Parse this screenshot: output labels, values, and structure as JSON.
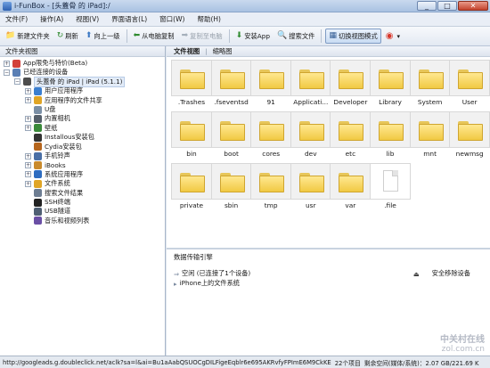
{
  "window": {
    "title": "i-FunBox - [头蓋骨 的 iPad]:/"
  },
  "menu": [
    "文件(F)",
    "操作(A)",
    "视图(V)",
    "界面语言(L)",
    "窗口(W)",
    "帮助(H)"
  ],
  "toolbar": [
    {
      "label": "新建文件夹",
      "icon": "folder-plus-icon",
      "glyph": "📁",
      "color": "#d4a019",
      "disabled": false
    },
    {
      "label": "刷新",
      "icon": "refresh-icon",
      "glyph": "↻",
      "color": "#2f8a2f",
      "disabled": false
    },
    {
      "label": "向上一级",
      "icon": "arrow-up-icon",
      "glyph": "⬆",
      "color": "#3b78c4",
      "disabled": false
    },
    {
      "label": "从电脑复制",
      "icon": "copy-from-pc-icon",
      "glyph": "⬅",
      "color": "#2f8a2f",
      "disabled": false
    },
    {
      "label": "复制至电脑",
      "icon": "copy-to-pc-icon",
      "glyph": "➡",
      "color": "#a5b0bb",
      "disabled": true
    },
    {
      "label": "安装App",
      "icon": "install-app-icon",
      "glyph": "⬇",
      "color": "#2f8a2f",
      "disabled": false
    },
    {
      "label": "搜索文件",
      "icon": "search-icon",
      "glyph": "🔍",
      "color": "#355e95",
      "disabled": false
    },
    {
      "label": "切换视图模式",
      "icon": "view-toggle-icon",
      "glyph": "▦",
      "color": "#355e95",
      "disabled": false,
      "active": true
    }
  ],
  "left_pane": {
    "header": "文件夹视图",
    "tree": [
      {
        "label": "App限免与特价(Beta)",
        "level": 0,
        "expander": "+",
        "icon": "apple-icon",
        "color": "#d2413a"
      },
      {
        "label": "已经连接的设备",
        "level": 0,
        "expander": "−",
        "icon": "devices-icon",
        "color": "#5a7fb5"
      },
      {
        "label": "头蓋骨 的 iPad | iPad (5.1.1)",
        "level": 1,
        "expander": "−",
        "icon": "ipad-icon",
        "color": "#4d4d4d",
        "selected": true
      },
      {
        "label": "用户应用程序",
        "level": 2,
        "expander": "+",
        "icon": "user-apps-icon",
        "color": "#3b7fd0"
      },
      {
        "label": "应用程序的文件共享",
        "level": 2,
        "expander": "+",
        "icon": "file-share-icon",
        "color": "#e0a526"
      },
      {
        "label": "U盘",
        "level": 2,
        "expander": "",
        "icon": "usb-drive-icon",
        "color": "#7a8fa6"
      },
      {
        "label": "内置相机",
        "level": 2,
        "expander": "+",
        "icon": "camera-icon",
        "color": "#555f6b"
      },
      {
        "label": "壁纸",
        "level": 2,
        "expander": "+",
        "icon": "wallpaper-icon",
        "color": "#3a8a3a"
      },
      {
        "label": "Installous安装包",
        "level": 2,
        "expander": "",
        "icon": "installous-icon",
        "color": "#333333"
      },
      {
        "label": "Cydia安装包",
        "level": 2,
        "expander": "",
        "icon": "cydia-icon",
        "color": "#b5651d"
      },
      {
        "label": "手机铃声",
        "level": 2,
        "expander": "+",
        "icon": "ringtone-icon",
        "color": "#4a6fa5"
      },
      {
        "label": "iBooks",
        "level": 2,
        "expander": "+",
        "icon": "ibooks-icon",
        "color": "#c98a2c"
      },
      {
        "label": "系统应用程序",
        "level": 2,
        "expander": "+",
        "icon": "system-apps-icon",
        "color": "#2d6cc0"
      },
      {
        "label": "文件系统",
        "level": 2,
        "expander": "+",
        "icon": "file-system-icon",
        "color": "#e0a526"
      },
      {
        "label": "搜索文件结果",
        "level": 2,
        "expander": "",
        "icon": "search-results-icon",
        "color": "#6d7d92"
      },
      {
        "label": "SSH终端",
        "level": 2,
        "expander": "",
        "icon": "ssh-terminal-icon",
        "color": "#222222"
      },
      {
        "label": "USB隧道",
        "level": 2,
        "expander": "",
        "icon": "usb-tunnel-icon",
        "color": "#4f5f73"
      },
      {
        "label": "音乐和视频列表",
        "level": 2,
        "expander": "",
        "icon": "media-list-icon",
        "color": "#6a4fa5"
      }
    ]
  },
  "right_pane": {
    "tabs": [
      {
        "label": "文件视图",
        "selected": true
      },
      {
        "label": "缩略图",
        "selected": false
      }
    ],
    "files": [
      {
        "name": ".Trashes",
        "type": "folder"
      },
      {
        "name": ".fseventsd",
        "type": "folder"
      },
      {
        "name": "91",
        "type": "folder"
      },
      {
        "name": "Applicati...",
        "type": "folder"
      },
      {
        "name": "Developer",
        "type": "folder"
      },
      {
        "name": "Library",
        "type": "folder"
      },
      {
        "name": "System",
        "type": "folder"
      },
      {
        "name": "User",
        "type": "folder"
      },
      {
        "name": "bin",
        "type": "folder"
      },
      {
        "name": "boot",
        "type": "folder"
      },
      {
        "name": "cores",
        "type": "folder"
      },
      {
        "name": "dev",
        "type": "folder"
      },
      {
        "name": "etc",
        "type": "folder"
      },
      {
        "name": "lib",
        "type": "folder"
      },
      {
        "name": "mnt",
        "type": "folder"
      },
      {
        "name": "newmsg",
        "type": "folder"
      },
      {
        "name": "private",
        "type": "folder"
      },
      {
        "name": "sbin",
        "type": "folder"
      },
      {
        "name": "tmp",
        "type": "folder"
      },
      {
        "name": "usr",
        "type": "folder"
      },
      {
        "name": "var",
        "type": "folder"
      },
      {
        "name": ".file",
        "type": "file"
      }
    ]
  },
  "transfer": {
    "header": "数据传输引擎",
    "status": "空闲 (已连接了1个设备)",
    "item": "iPhone上的文件系统",
    "eject": "安全移除设备"
  },
  "statusbar": {
    "url": "http://googleads.g.doubleclick.net/aclk?sa=l&ai=Bu1aAabQSUOCgDILFigeEqblr6e695AKRvfyFPImE6M9CkKE",
    "items": "22个项目",
    "space": "剩余空间(媒体/系统)：2.07 GB/221.69 K"
  },
  "watermark": {
    "cn": "中关村在线",
    "url": "zol.com.cn"
  }
}
